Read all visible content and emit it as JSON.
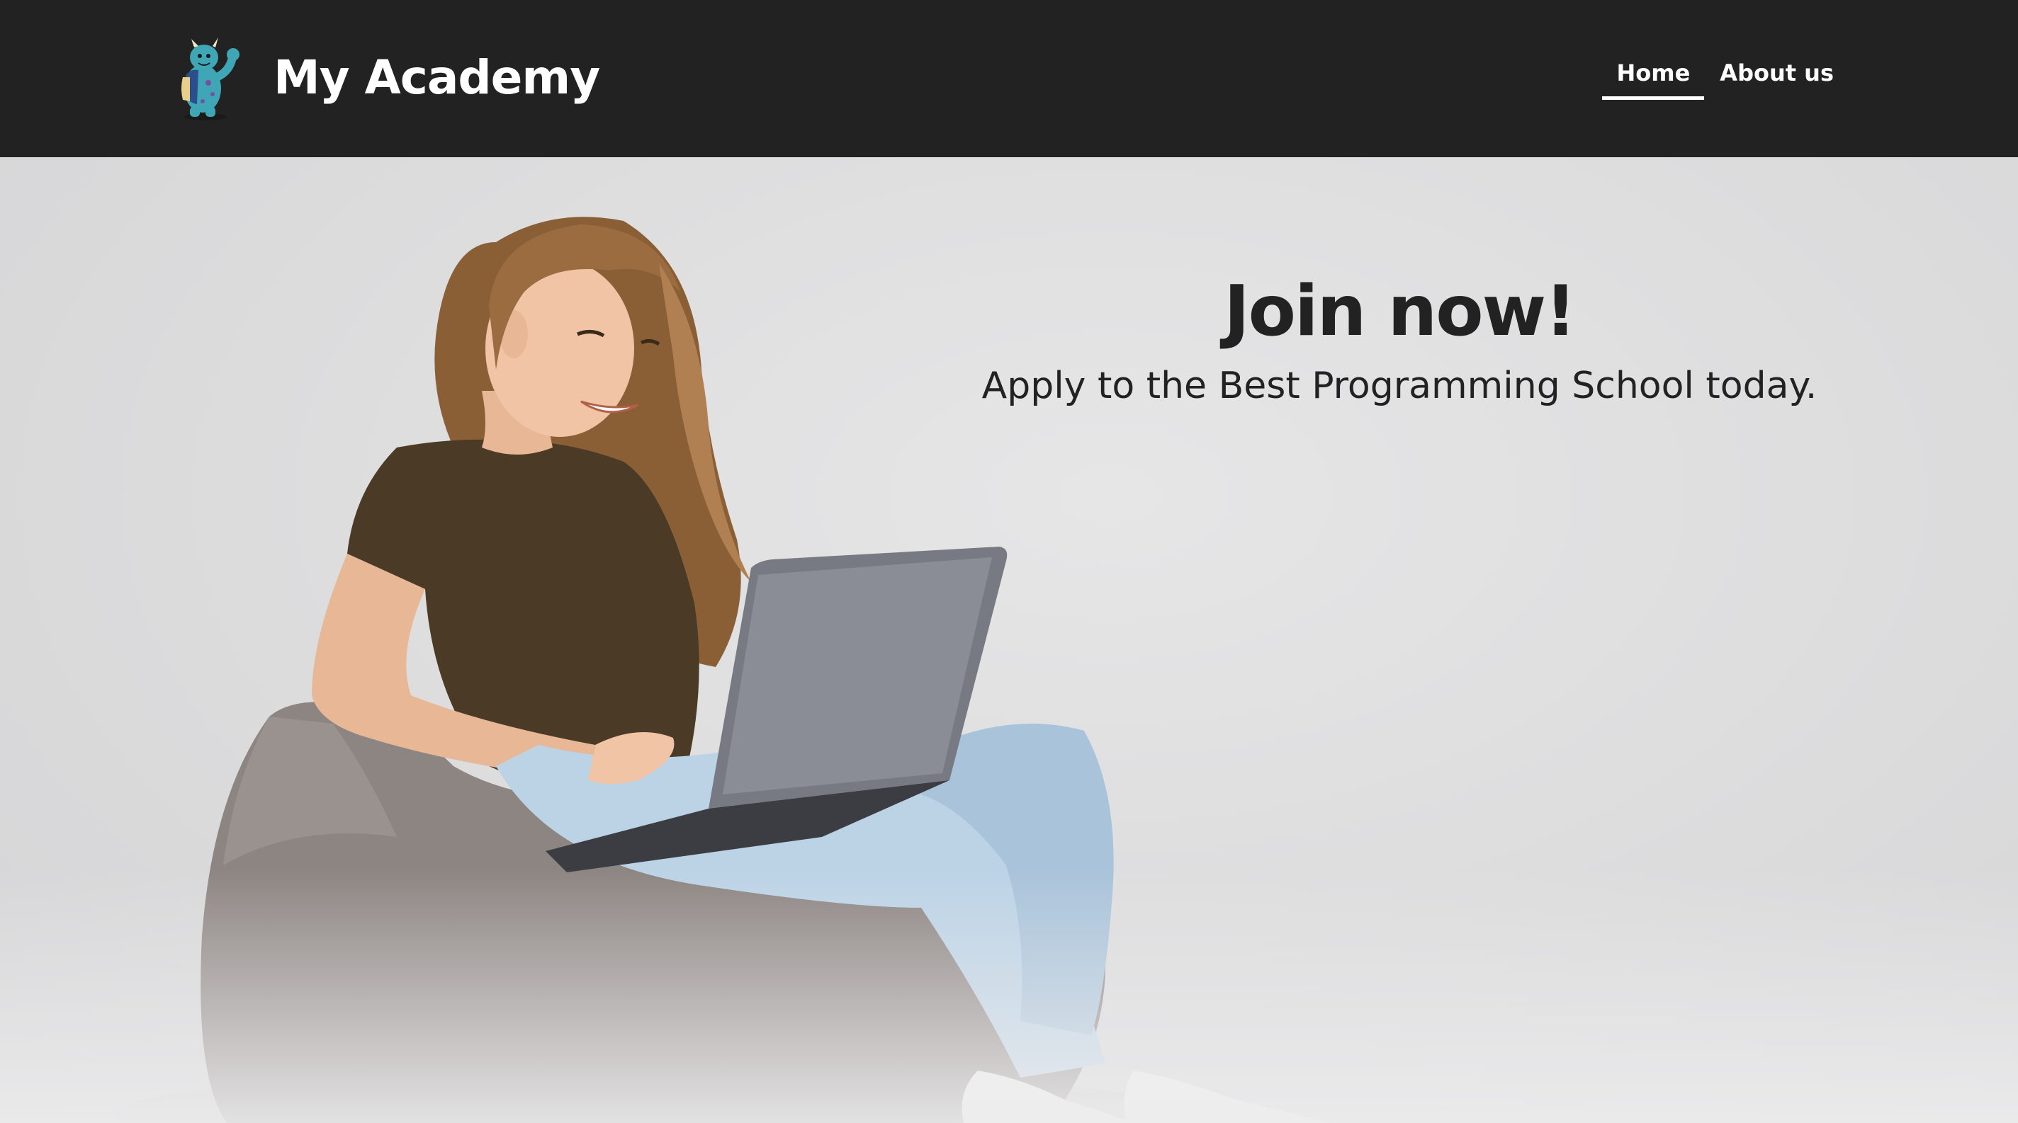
{
  "header": {
    "brand": {
      "title": "My Academy",
      "logo_icon": "monster-mascot-icon"
    },
    "nav": {
      "items": [
        {
          "label": "Home",
          "active": true
        },
        {
          "label": "About us",
          "active": false
        }
      ]
    }
  },
  "hero": {
    "title": "Join now!",
    "subtitle": "Apply to the Best Programming School today.",
    "image": "student-with-laptop-on-beanbag-photo"
  },
  "colors": {
    "header_bg": "#222222",
    "header_text": "#ffffff",
    "hero_bg": "#dededf",
    "hero_text": "#222222"
  }
}
